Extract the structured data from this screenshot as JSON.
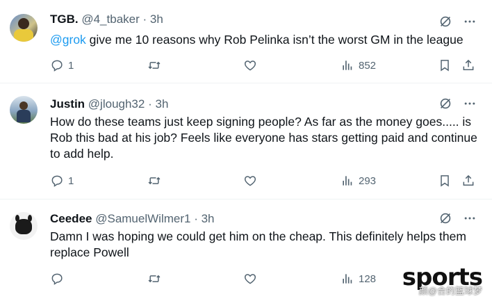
{
  "tweets": [
    {
      "name": "TGB.",
      "handle": "@4_tbaker",
      "time": "3h",
      "mention": "@grok",
      "text": " give me 10 reasons why Rob Pelinka isn’t the worst GM in the league",
      "replies": "1",
      "retweets": "",
      "likes": "",
      "views": "852"
    },
    {
      "name": "Justin",
      "handle": "@jlough32",
      "time": "3h",
      "text": "How do these teams just keep signing people? As far as the money goes..... is Rob this bad at his job? Feels like everyone has stars getting paid and continue to add help.",
      "replies": "1",
      "retweets": "",
      "likes": "",
      "views": "293"
    },
    {
      "name": "Ceedee",
      "handle": "@SamuelWilmer1",
      "time": "3h",
      "text": "Damn I was hoping we could get him on the cheap. This definitely helps them replace Powell",
      "replies": "",
      "retweets": "",
      "likes": "",
      "views": "128"
    }
  ],
  "separator": "·",
  "watermark": "sports",
  "watermark_sub": "颜@合的篮球梦",
  "icons": {
    "reply": "reply-icon",
    "retweet": "retweet-icon",
    "like": "heart-icon",
    "views": "views-icon",
    "bookmark": "bookmark-icon",
    "share": "share-icon",
    "grok": "grok-icon",
    "more": "more-icon"
  },
  "colors": {
    "link": "#1d9bf0",
    "secondary": "#536471",
    "text": "#0f1419"
  }
}
